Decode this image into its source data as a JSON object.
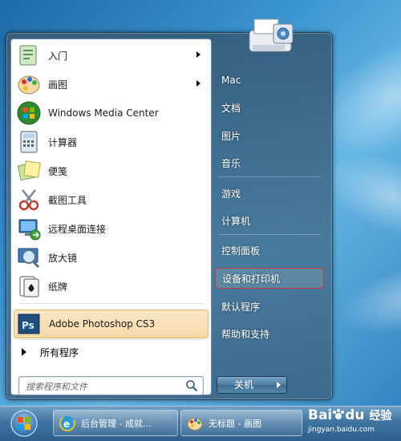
{
  "start_menu": {
    "programs": [
      {
        "label": "入门",
        "icon": "getting-started-icon",
        "has_submenu": true
      },
      {
        "label": "画图",
        "icon": "paint-icon",
        "has_submenu": true
      },
      {
        "label": "Windows Media Center",
        "icon": "media-center-icon",
        "has_submenu": false
      },
      {
        "label": "计算器",
        "icon": "calculator-icon",
        "has_submenu": false
      },
      {
        "label": "便笺",
        "icon": "sticky-notes-icon",
        "has_submenu": false
      },
      {
        "label": "截图工具",
        "icon": "snipping-tool-icon",
        "has_submenu": false
      },
      {
        "label": "远程桌面连接",
        "icon": "remote-desktop-icon",
        "has_submenu": false
      },
      {
        "label": "放大镜",
        "icon": "magnifier-icon",
        "has_submenu": false
      },
      {
        "label": "纸牌",
        "icon": "solitaire-icon",
        "has_submenu": false
      },
      {
        "label": "Adobe Photoshop CS3",
        "icon": "photoshop-icon",
        "has_submenu": false,
        "highlighted": true
      }
    ],
    "all_programs_label": "所有程序",
    "search_placeholder": "搜索程序和文件",
    "right_items": [
      {
        "label": "Mac"
      },
      {
        "label": "文档"
      },
      {
        "label": "图片"
      },
      {
        "label": "音乐"
      },
      {
        "label": "游戏"
      },
      {
        "label": "计算机"
      },
      {
        "label": "控制面板"
      },
      {
        "label": "设备和打印机",
        "outlined": true
      },
      {
        "label": "默认程序"
      },
      {
        "label": "帮助和支持"
      }
    ],
    "shutdown_label": "关机",
    "user_picture": "printer-icon"
  },
  "taskbar": {
    "tasks": [
      {
        "label": "后台管理 - 成就...",
        "icon": "ie-icon"
      },
      {
        "label": "无标题 - 画图",
        "icon": "paint-icon"
      }
    ]
  },
  "watermark": {
    "brand": "Bai",
    "brand2": "du",
    "suffix": "经验",
    "url": "jingyan.baidu.com"
  },
  "colors": {
    "highlight": "#f7d9a8",
    "outline": "#c33a3a",
    "panel_frame": "#466e92"
  }
}
